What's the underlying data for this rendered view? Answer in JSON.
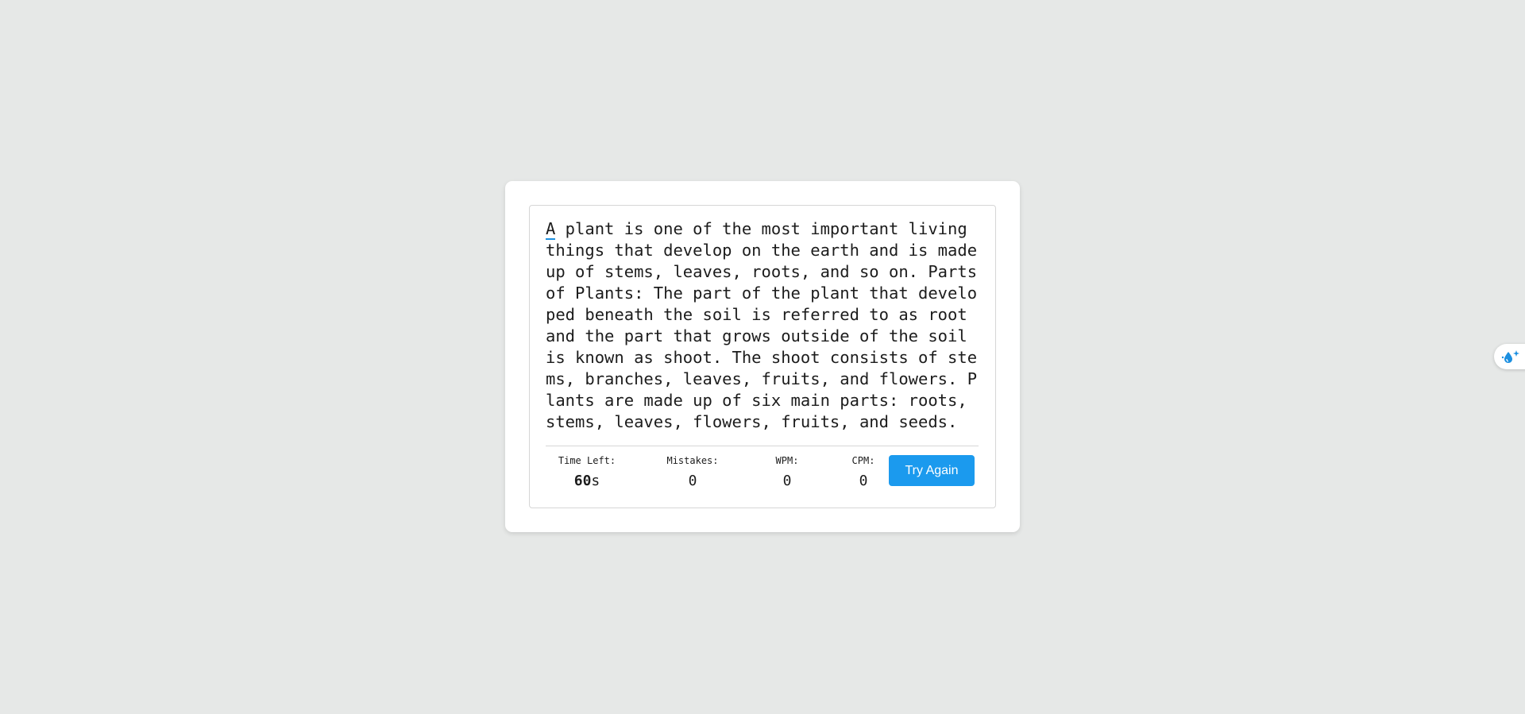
{
  "typing": {
    "current_char": "A",
    "rest_text": " plant is one of the most important living things that develop on the earth and is made up of stems, leaves, roots, and so on. Parts of Plants: The part of the plant that developed beneath the soil is referred to as root and the part that grows outside of the soil is known as shoot. The shoot consists of stems, branches, leaves, fruits, and flowers. Plants are made up of six main parts: roots, stems, leaves, flowers, fruits, and seeds."
  },
  "stats": {
    "time_label": "Time Left:",
    "time_value": "60",
    "time_unit": "s",
    "mistakes_label": "Mistakes:",
    "mistakes_value": "0",
    "wpm_label": "WPM:",
    "wpm_value": "0",
    "cpm_label": "CPM:",
    "cpm_value": "0"
  },
  "buttons": {
    "try_again": "Try Again"
  },
  "colors": {
    "background": "#e6e8e7",
    "accent": "#1b9aee",
    "cursor_underline": "#1b8fe0"
  },
  "icons": {
    "extension": "droplet-sparkle-icon"
  }
}
